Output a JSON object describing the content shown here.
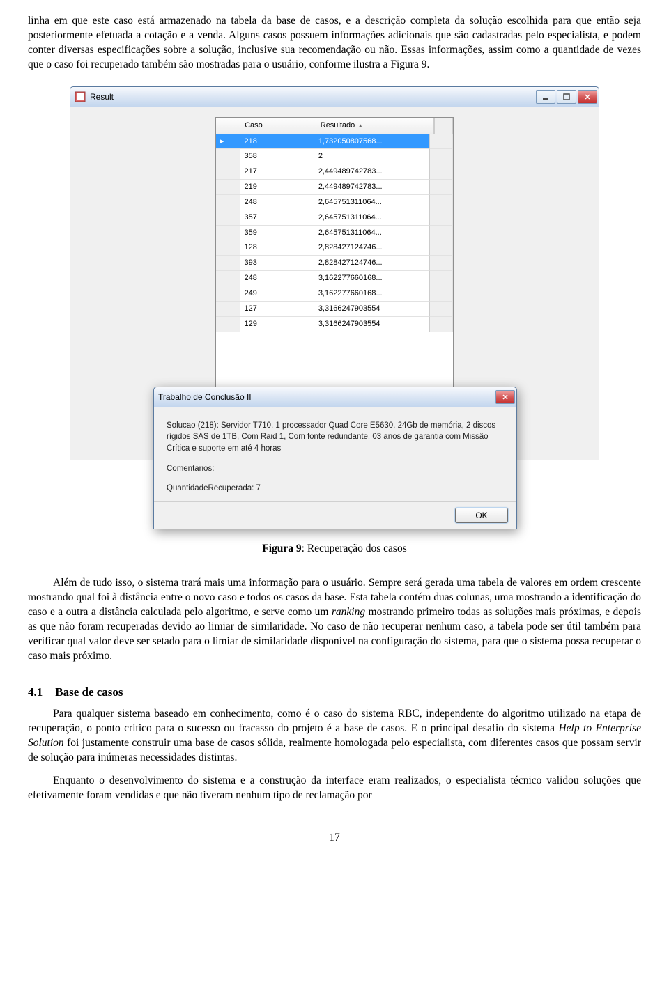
{
  "para1": "linha em que este caso está armazenado na tabela da base de casos, e a descrição completa da solução escolhida para que então seja posteriormente efetuada a cotação e a venda. Alguns casos possuem informações adicionais que são cadastradas pelo especialista, e podem conter diversas especificações sobre a solução, inclusive sua recomendação ou não. Essas informações, assim como a quantidade de vezes que o caso foi recuperado também são mostradas para o usuário, conforme ilustra a Figura 9.",
  "window1": {
    "title": "Result"
  },
  "grid": {
    "columns": [
      "",
      "Caso",
      "Resultado"
    ],
    "sortcol": "Resultado",
    "rows": [
      {
        "rh": "▸",
        "caso": "218",
        "res": "1,732050807568...",
        "sel": true
      },
      {
        "rh": "",
        "caso": "358",
        "res": "2"
      },
      {
        "rh": "",
        "caso": "217",
        "res": "2,449489742783..."
      },
      {
        "rh": "",
        "caso": "219",
        "res": "2,449489742783..."
      },
      {
        "rh": "",
        "caso": "248",
        "res": "2,645751311064..."
      },
      {
        "rh": "",
        "caso": "357",
        "res": "2,645751311064..."
      },
      {
        "rh": "",
        "caso": "359",
        "res": "2,645751311064..."
      },
      {
        "rh": "",
        "caso": "128",
        "res": "2,828427124746..."
      },
      {
        "rh": "",
        "caso": "393",
        "res": "2,828427124746..."
      },
      {
        "rh": "",
        "caso": "248",
        "res": "3,162277660168..."
      },
      {
        "rh": "",
        "caso": "249",
        "res": "3,162277660168..."
      },
      {
        "rh": "",
        "caso": "127",
        "res": "3,3166247903554"
      },
      {
        "rh": "",
        "caso": "129",
        "res": "3,3166247903554"
      }
    ]
  },
  "dialog": {
    "title": "Trabalho de Conclusão II",
    "line1": "Solucao (218): Servidor T710, 1 processador Quad Core E5630,  24Gb de memória, 2 discos rígidos SAS de 1TB, Com Raid 1, Com fonte redundante, 03 anos de garantia com  Missão Crítica e suporte em até 4 horas",
    "line2": "Comentarios:",
    "line3": "QuantidadeRecuperada: 7",
    "ok": "OK"
  },
  "figcap_b": "Figura 9",
  "figcap_t": ": Recuperação dos casos",
  "para2": "Além de tudo isso, o sistema trará mais uma informação para o usuário. Sempre será gerada uma tabela de valores em ordem crescente mostrando qual foi à distância entre o novo caso e todos os casos da base. Esta tabela contém duas colunas, uma mostrando a identificação do caso e a outra a distância calculada pelo algoritmo, e serve como um ",
  "para2_i": "ranking",
  "para2_c": " mostrando primeiro todas as soluções mais próximas, e depois as que não foram recuperadas devido ao limiar de similaridade. No caso de não recuperar nenhum caso, a tabela pode ser útil também para verificar qual valor deve ser setado para o limiar de similaridade disponível na configuração do sistema, para que o sistema possa recuperar o caso mais próximo.",
  "h3num": "4.1",
  "h3txt": "Base de casos",
  "para3a": "Para qualquer sistema baseado em conhecimento, como é o caso do sistema RBC, independente do algoritmo utilizado na etapa de recuperação, o ponto crítico para o sucesso ou fracasso do projeto é a base de casos. E o principal desafio do sistema ",
  "para3a_i": "Help to Enterprise Solution",
  "para3a_c": " foi justamente construir uma base de casos sólida, realmente homologada pelo especialista, com diferentes casos que possam servir de solução para inúmeras necessidades distintas.",
  "para3b": "Enquanto o desenvolvimento do sistema e a construção da interface eram realizados, o especialista técnico validou soluções que efetivamente foram vendidas e que não tiveram nenhum tipo de reclamação por",
  "pagenum": "17"
}
